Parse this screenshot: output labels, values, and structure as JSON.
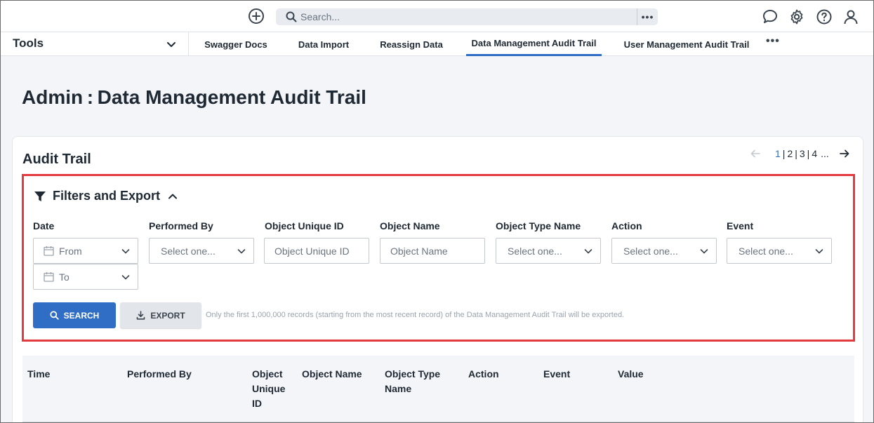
{
  "topbar": {
    "search_placeholder": "Search...",
    "more_label": "•••",
    "icons": [
      "add-icon",
      "search-icon",
      "more-icon",
      "chat-icon",
      "gear-icon",
      "help-icon",
      "user-icon"
    ]
  },
  "nav": {
    "tools_label": "Tools",
    "tabs": [
      {
        "label": "Swagger Docs"
      },
      {
        "label": "Data Import"
      },
      {
        "label": "Reassign Data"
      },
      {
        "label": "Data Management Audit Trail",
        "active": true
      },
      {
        "label": "User Management Audit Trail"
      }
    ],
    "more_label": "•••"
  },
  "page": {
    "title": "Admin : Data Management Audit Trail"
  },
  "card": {
    "title": "Audit Trail",
    "pager": {
      "pages": [
        "1",
        "2",
        "3",
        "4"
      ],
      "separator": "|",
      "ellipsis": "...",
      "current": "1"
    }
  },
  "filters": {
    "heading": "Filters and Export",
    "date_label": "Date",
    "date_from": "From",
    "date_to": "To",
    "performed_by_label": "Performed By",
    "performed_by_value": "Select one...",
    "object_uid_label": "Object Unique ID",
    "object_uid_placeholder": "Object Unique ID",
    "object_name_label": "Object Name",
    "object_name_placeholder": "Object Name",
    "object_type_label": "Object Type Name",
    "object_type_value": "Select one...",
    "action_label": "Action",
    "action_value": "Select one...",
    "event_label": "Event",
    "event_value": "Select one...",
    "search_button": "SEARCH",
    "export_button": "EXPORT",
    "export_note": "Only the first 1,000,000 records (starting from the most recent record) of the Data Management Audit Trail will be exported."
  },
  "table": {
    "columns": [
      "Time",
      "Performed By",
      "Object Unique ID",
      "Object Name",
      "Object Type Name",
      "Action",
      "Event",
      "Value"
    ]
  },
  "colors": {
    "accent": "#2f6ec4",
    "highlight_border": "#e3393f"
  }
}
